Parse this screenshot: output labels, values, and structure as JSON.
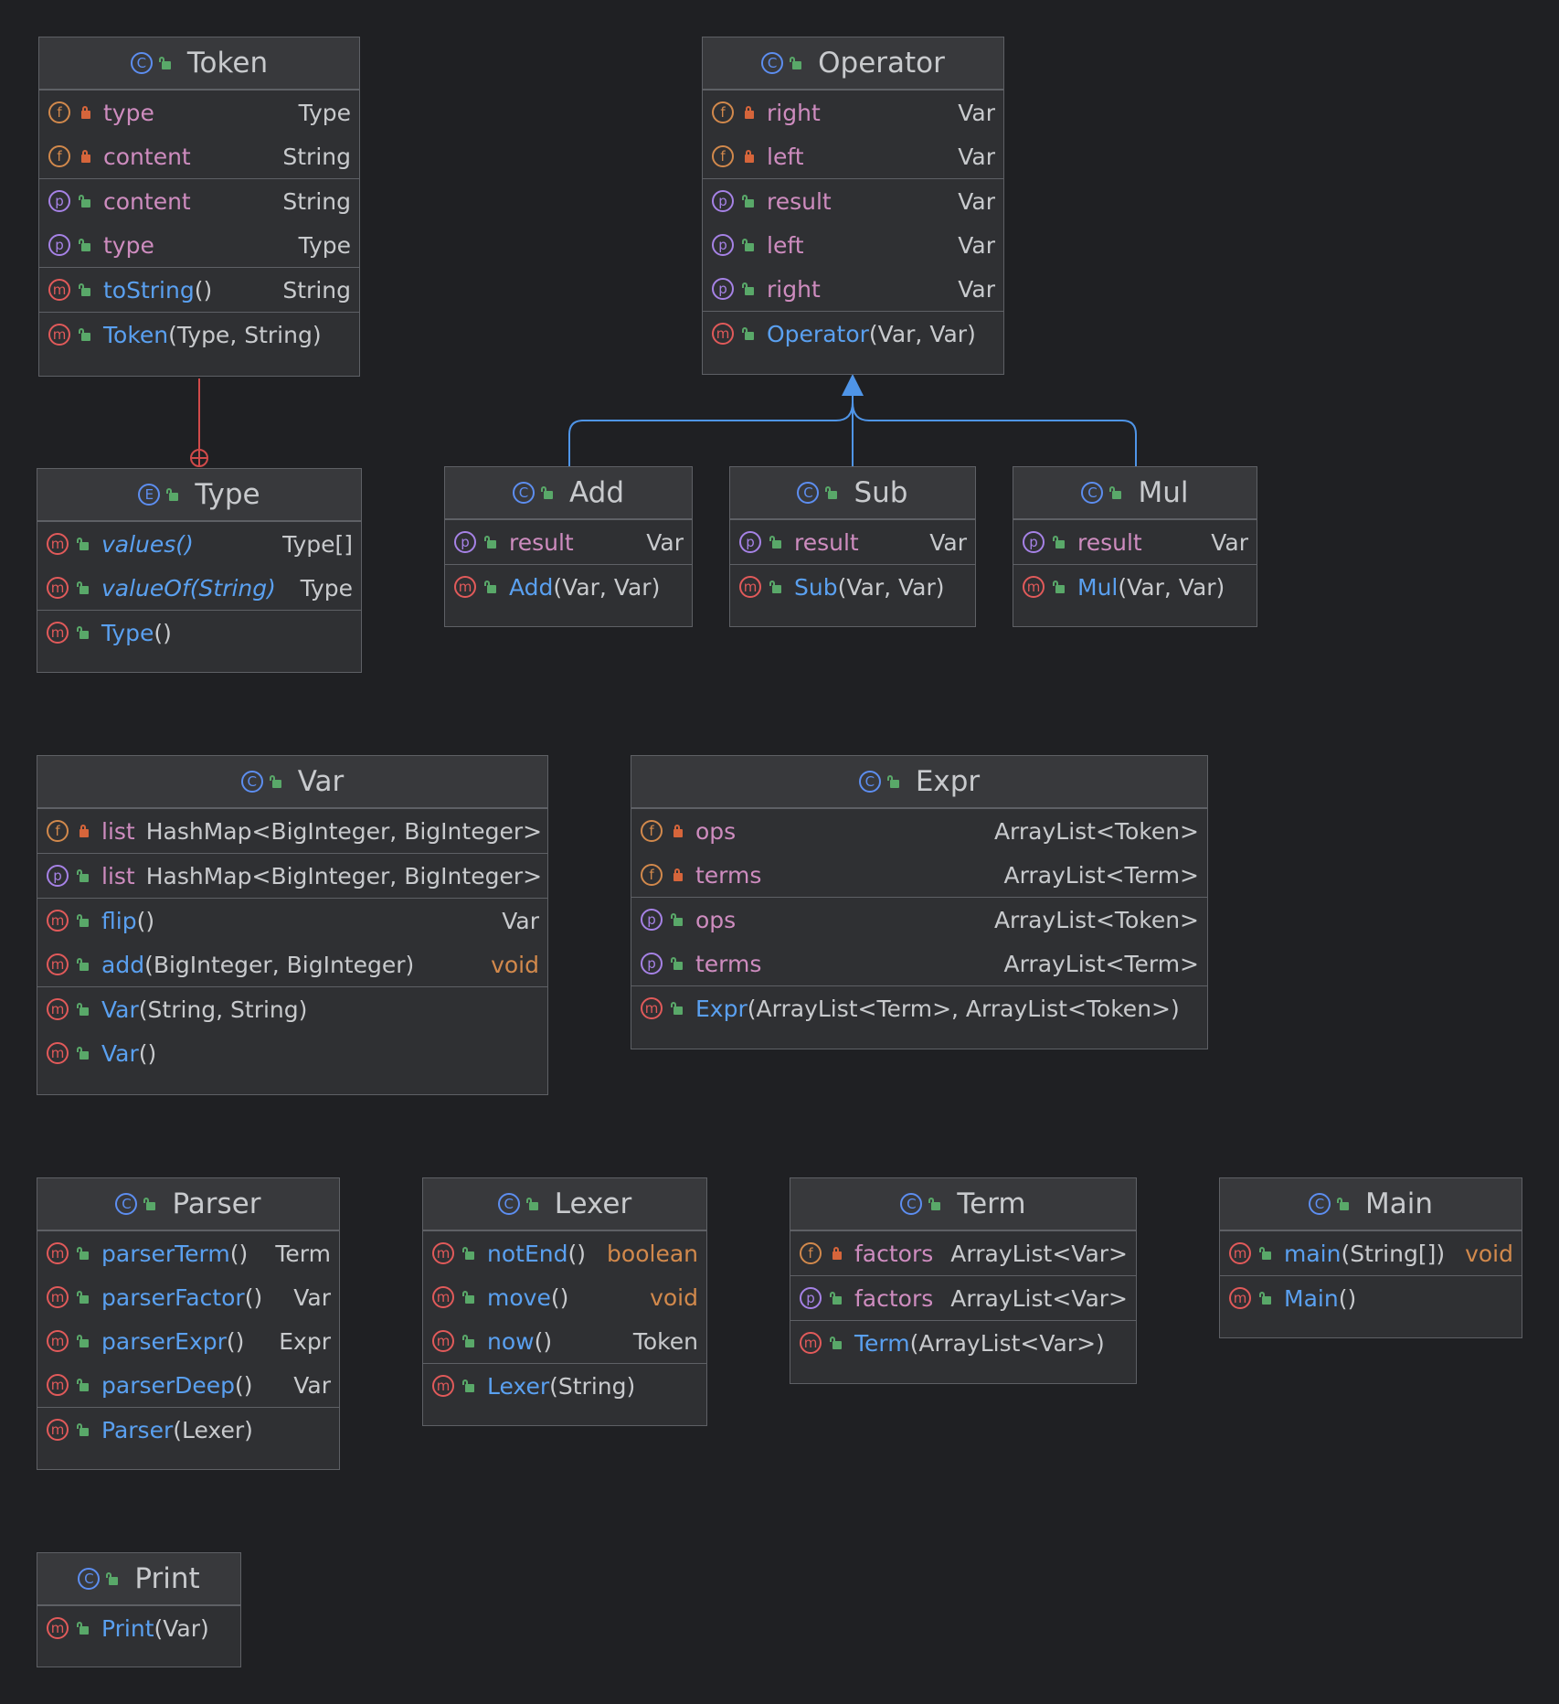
{
  "classes": {
    "token": {
      "name": "Token",
      "fields": [
        {
          "name": "type",
          "type": "Type"
        },
        {
          "name": "content",
          "type": "String"
        }
      ],
      "props": [
        {
          "name": "content",
          "type": "String"
        },
        {
          "name": "type",
          "type": "Type"
        }
      ],
      "methods": [
        {
          "name": "toString",
          "params": "()",
          "type": "String"
        }
      ],
      "ctors": [
        {
          "name": "Token",
          "params": "(Type, String)"
        }
      ]
    },
    "type": {
      "name": "Type",
      "methods": [
        {
          "name": "values()",
          "type": "Type[]"
        },
        {
          "name": "valueOf(String)",
          "type": "Type"
        }
      ],
      "ctors": [
        {
          "name": "Type",
          "params": "()"
        }
      ]
    },
    "operator": {
      "name": "Operator",
      "fields": [
        {
          "name": "right",
          "type": "Var"
        },
        {
          "name": "left",
          "type": "Var"
        }
      ],
      "props": [
        {
          "name": "result",
          "type": "Var"
        },
        {
          "name": "left",
          "type": "Var"
        },
        {
          "name": "right",
          "type": "Var"
        }
      ],
      "ctors": [
        {
          "name": "Operator",
          "params": "(Var, Var)"
        }
      ]
    },
    "add": {
      "name": "Add",
      "props": [
        {
          "name": "result",
          "type": "Var"
        }
      ],
      "ctors": [
        {
          "name": "Add",
          "params": "(Var, Var)"
        }
      ]
    },
    "sub": {
      "name": "Sub",
      "props": [
        {
          "name": "result",
          "type": "Var"
        }
      ],
      "ctors": [
        {
          "name": "Sub",
          "params": "(Var, Var)"
        }
      ]
    },
    "mul": {
      "name": "Mul",
      "props": [
        {
          "name": "result",
          "type": "Var"
        }
      ],
      "ctors": [
        {
          "name": "Mul",
          "params": "(Var, Var)"
        }
      ]
    },
    "var": {
      "name": "Var",
      "fields": [
        {
          "name": "list",
          "type": "HashMap<BigInteger, BigInteger>"
        }
      ],
      "props": [
        {
          "name": "list",
          "type": "HashMap<BigInteger, BigInteger>"
        }
      ],
      "methods": [
        {
          "name": "flip",
          "params": "()",
          "type": "Var"
        },
        {
          "name": "add",
          "params": "(BigInteger, BigInteger)",
          "type": "void"
        }
      ],
      "ctors": [
        {
          "name": "Var",
          "params": "(String, String)"
        },
        {
          "name": "Var",
          "params": "()"
        }
      ]
    },
    "expr": {
      "name": "Expr",
      "fields": [
        {
          "name": "ops",
          "type": "ArrayList<Token>"
        },
        {
          "name": "terms",
          "type": "ArrayList<Term>"
        }
      ],
      "props": [
        {
          "name": "ops",
          "type": "ArrayList<Token>"
        },
        {
          "name": "terms",
          "type": "ArrayList<Term>"
        }
      ],
      "ctors": [
        {
          "name": "Expr",
          "params": "(ArrayList<Term>, ArrayList<Token>)"
        }
      ]
    },
    "parser": {
      "name": "Parser",
      "methods": [
        {
          "name": "parserTerm",
          "params": "()",
          "type": "Term"
        },
        {
          "name": "parserFactor",
          "params": "()",
          "type": "Var"
        },
        {
          "name": "parserExpr",
          "params": "()",
          "type": "Expr"
        },
        {
          "name": "parserDeep",
          "params": "()",
          "type": "Var"
        }
      ],
      "ctors": [
        {
          "name": "Parser",
          "params": "(Lexer)"
        }
      ]
    },
    "lexer": {
      "name": "Lexer",
      "methods": [
        {
          "name": "notEnd",
          "params": "()",
          "type": "boolean"
        },
        {
          "name": "move",
          "params": "()",
          "type": "void"
        },
        {
          "name": "now",
          "params": "()",
          "type": "Token"
        }
      ],
      "ctors": [
        {
          "name": "Lexer",
          "params": "(String)"
        }
      ]
    },
    "term": {
      "name": "Term",
      "fields": [
        {
          "name": "factors",
          "type": "ArrayList<Var>"
        }
      ],
      "props": [
        {
          "name": "factors",
          "type": "ArrayList<Var>"
        }
      ],
      "ctors": [
        {
          "name": "Term",
          "params": "(ArrayList<Var>)"
        }
      ]
    },
    "main": {
      "name": "Main",
      "methods": [
        {
          "name": "main",
          "params": "(String[])",
          "type": "void"
        }
      ],
      "ctors": [
        {
          "name": "Main",
          "params": "()"
        }
      ]
    },
    "print": {
      "name": "Print",
      "ctors": [
        {
          "name": "Print",
          "params": "(Var)"
        }
      ]
    }
  },
  "icons": {
    "class": "C",
    "enum": "E",
    "field": "f",
    "property": "p",
    "method": "m"
  },
  "colors": {
    "background": "#1f2023",
    "box": "#2f3033",
    "header": "#38393c",
    "border": "#5e6065",
    "field_name": "#ce8cbf",
    "method_name": "#5aa0f0",
    "inheritance_arrow": "#4f95e8",
    "nested_link": "#d04a4a"
  }
}
